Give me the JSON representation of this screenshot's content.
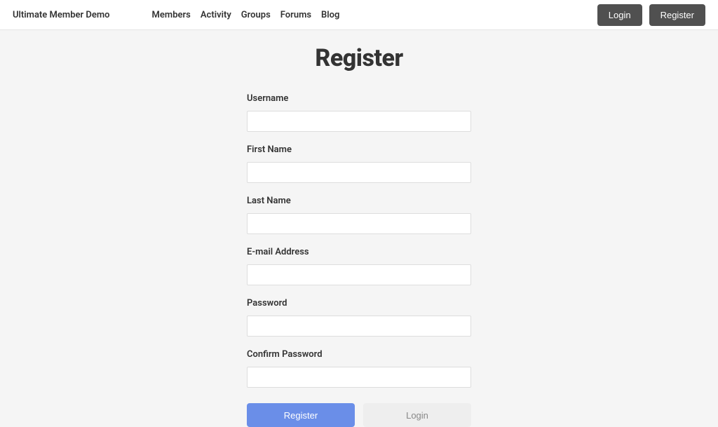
{
  "header": {
    "brand": "Ultimate Member Demo",
    "nav": {
      "members": "Members",
      "activity": "Activity",
      "groups": "Groups",
      "forums": "Forums",
      "blog": "Blog"
    },
    "login_label": "Login",
    "register_label": "Register"
  },
  "page": {
    "title": "Register"
  },
  "form": {
    "username": {
      "label": "Username",
      "value": ""
    },
    "first_name": {
      "label": "First Name",
      "value": ""
    },
    "last_name": {
      "label": "Last Name",
      "value": ""
    },
    "email": {
      "label": "E-mail Address",
      "value": ""
    },
    "password": {
      "label": "Password",
      "value": ""
    },
    "confirm_password": {
      "label": "Confirm Password",
      "value": ""
    },
    "submit_label": "Register",
    "login_label": "Login"
  }
}
